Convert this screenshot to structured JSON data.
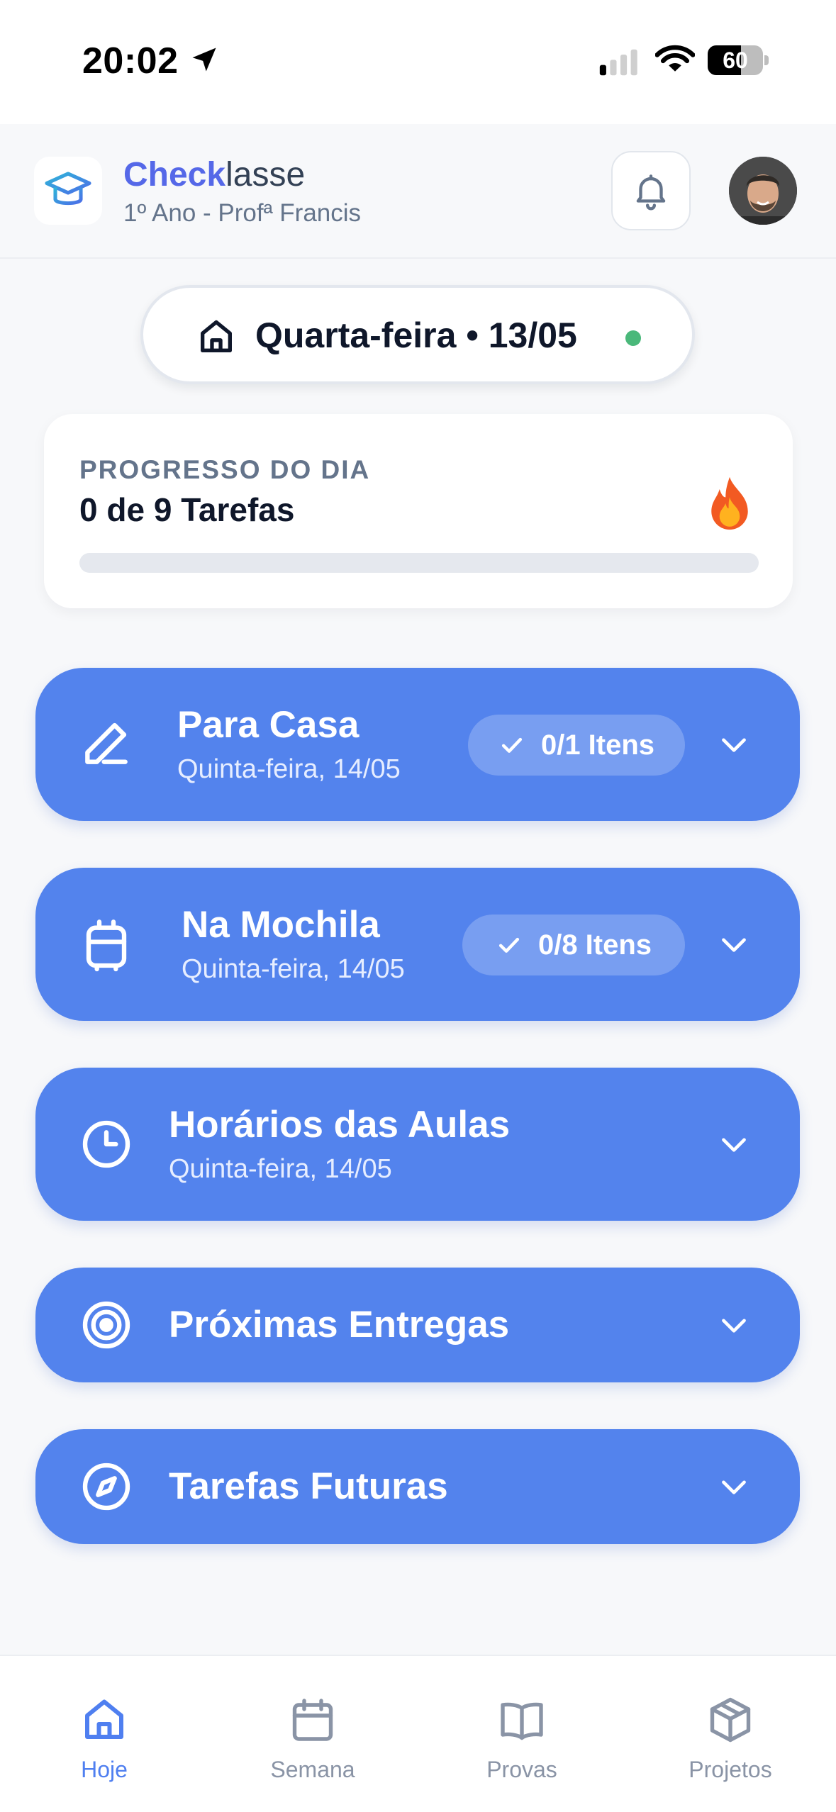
{
  "status_bar": {
    "time": "20:02",
    "battery": "60",
    "battery_level": 0.6
  },
  "header": {
    "brand_strong": "Check",
    "brand_rest": "lasse",
    "subtitle": "1º Ano - Profª Francis",
    "logo_icon": "graduation-cap-icon",
    "notifications_icon": "bell-icon"
  },
  "date_pill": {
    "text": "Quarta-feira • 13/05",
    "icon": "home-icon",
    "status_color": "#4ab87a"
  },
  "progress": {
    "label": "PROGRESSO DO DIA",
    "count": "0 de 9 Tarefas",
    "fraction": 0,
    "icon": "fire-icon"
  },
  "sections": [
    {
      "title": "Para Casa",
      "subtitle": "Quinta-feira, 14/05",
      "badge": "0/1 Itens",
      "icon": "pencil-icon"
    },
    {
      "title": "Na Mochila",
      "subtitle": "Quinta-feira, 14/05",
      "badge": "0/8 Itens",
      "icon": "backpack-icon"
    },
    {
      "title": "Horários das Aulas",
      "subtitle": "Quinta-feira, 14/05",
      "icon": "clock-icon"
    },
    {
      "title": "Próximas Entregas",
      "icon": "target-icon"
    },
    {
      "title": "Tarefas Futuras",
      "icon": "compass-icon"
    }
  ],
  "nav": {
    "active": "Hoje",
    "items": [
      {
        "label": "Hoje",
        "icon": "home-icon"
      },
      {
        "label": "Semana",
        "icon": "calendar-icon"
      },
      {
        "label": "Provas",
        "icon": "book-icon"
      },
      {
        "label": "Projetos",
        "icon": "box-icon"
      }
    ]
  },
  "colors": {
    "accent": "#5383ed",
    "brand": "#5568e8",
    "background": "#f7f8fa"
  }
}
